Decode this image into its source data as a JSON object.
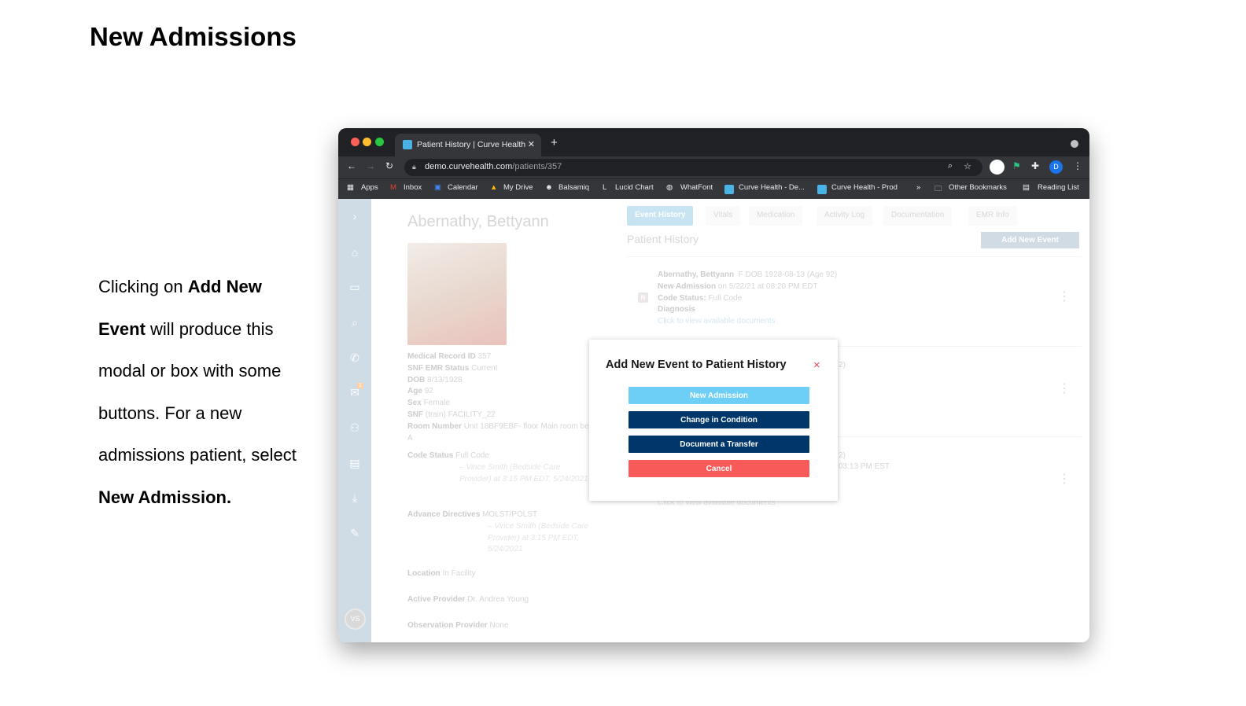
{
  "slide": {
    "title": "New Admissions",
    "description": [
      {
        "text": "Clicking on ",
        "bold": false
      },
      {
        "text": "Add New Event",
        "bold": true
      },
      {
        "text": " will produce this modal or box with some buttons. For a new admissions patient, select ",
        "bold": false
      },
      {
        "text": "New Admission.",
        "bold": true
      }
    ]
  },
  "browser": {
    "tab_title": "Patient History | Curve Health",
    "new_tab": "+",
    "url_host": "demo.curvehealth.com",
    "url_path": "/patients/357",
    "profile_initial": "D",
    "bookmarks": [
      "Apps",
      "Inbox",
      "Calendar",
      "My Drive",
      "Balsamiq",
      "Lucid Chart",
      "WhatFont",
      "Curve Health - De...",
      "Curve Health - Prod"
    ],
    "more": "»",
    "other_bookmarks": "Other Bookmarks",
    "reading_list": "Reading List"
  },
  "sidebar": {
    "avatar": "VS",
    "badge": "1",
    "icons": [
      "chevron-right-icon",
      "home-icon",
      "ticket-icon",
      "search-icon",
      "phone-icon",
      "mail-icon",
      "users-icon",
      "calendar-icon",
      "download-icon",
      "edit-icon"
    ]
  },
  "patient": {
    "name": "Abernathy, Bettyann",
    "fields": [
      {
        "label": "Medical Record ID",
        "value": "357"
      },
      {
        "label": "SNF EMR Status",
        "value": "Current"
      },
      {
        "label": "DOB",
        "value": "8/13/1928"
      },
      {
        "label": "Age",
        "value": "92"
      },
      {
        "label": "Sex",
        "value": "Female"
      },
      {
        "label": "SNF",
        "value": "(train) FACILITY_22"
      },
      {
        "label": "Room Number",
        "value": "Unit 18BF9EBF- floor Main room bed A"
      }
    ],
    "code_status": {
      "label": "Code Status",
      "value": "Full Code",
      "note": "– Vince Smith (Bedside Care Provider) at 3:15 PM EDT, 5/24/2021"
    },
    "advance_directives": {
      "label": "Advance Directives",
      "value": "MOLST/POLST",
      "note": "– Vince Smith (Bedside Care Provider) at 3:15 PM EDT, 5/24/2021"
    },
    "location": {
      "label": "Location",
      "value": "In Facility"
    },
    "active_provider": {
      "label": "Active Provider",
      "value": "Dr. Andrea Young"
    },
    "observation_provider": {
      "label": "Observation Provider",
      "value": "None"
    }
  },
  "tabs": [
    "Event History",
    "Vitals",
    "Medication",
    "Activity Log",
    "Documentation",
    "EMR Info"
  ],
  "history": {
    "title": "Patient History",
    "add_button": "Add New Event",
    "event1": {
      "badge": "N",
      "name": "Abernathy, Bettyann",
      "meta": "F DOB 1928-08-13 (Age 92)",
      "type": "New Admission",
      "when": "on 5/22/21 at 08:20 PM EDT",
      "code_label": "Code Status:",
      "code_value": "Full Code",
      "diagnosis": "Diagnosis",
      "link": "Click to view available documents"
    },
    "event2_fragment": "2)",
    "event3_fragment": "2)",
    "event3_time_fragment": "03:13 PM EST",
    "event3_link": "Click to view available documents"
  },
  "modal": {
    "title": "Add New Event to Patient History",
    "close": "×",
    "buttons": {
      "new_admission": "New Admission",
      "change": "Change in Condition",
      "transfer": "Document a Transfer",
      "cancel": "Cancel"
    },
    "colors": {
      "new_admission": "#6dcff6",
      "primary": "#00376b",
      "cancel": "#f85a5a"
    }
  }
}
